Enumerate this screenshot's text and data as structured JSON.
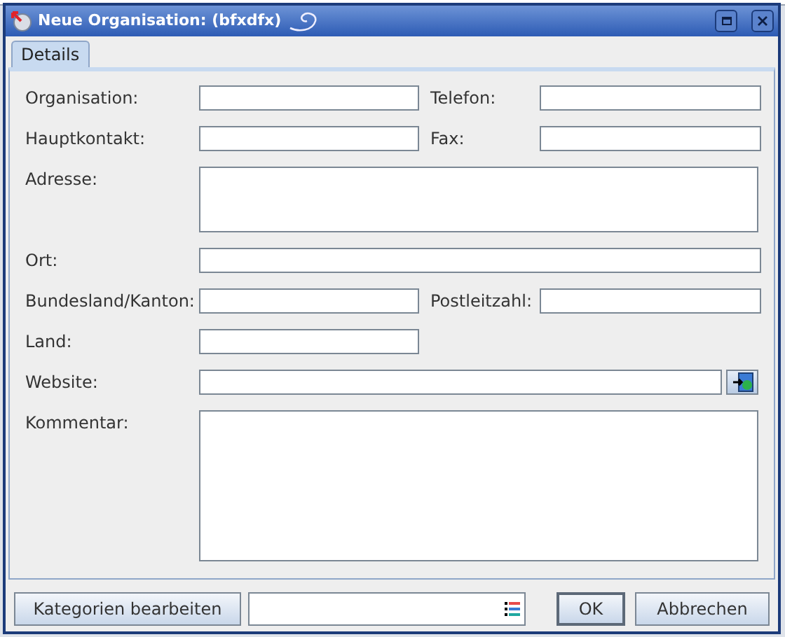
{
  "window": {
    "title": "Neue Organisation: (bfxdfx)"
  },
  "tabs": [
    {
      "label": "Details",
      "selected": true
    }
  ],
  "rows": [
    {
      "kind": "pair",
      "left": {
        "label": "Organisation:"
      },
      "right": {
        "label": "Telefon:"
      }
    },
    {
      "kind": "pair",
      "left": {
        "label": "Hauptkontakt:"
      },
      "right": {
        "label": "Fax:"
      }
    },
    {
      "kind": "area",
      "left": {
        "label": "Adresse:"
      }
    },
    {
      "kind": "wide",
      "left": {
        "label": "Ort:"
      }
    },
    {
      "kind": "pair",
      "left": {
        "label": "Bundesland/Kanton:"
      },
      "right": {
        "label": "Postleitzahl:"
      }
    },
    {
      "kind": "single",
      "left": {
        "label": "Land:"
      }
    },
    {
      "kind": "url",
      "left": {
        "label": "Website:"
      }
    },
    {
      "kind": "large_area",
      "left": {
        "label": "Kommentar:"
      }
    }
  ],
  "footer": {
    "categories_button": "Kategorien bearbeiten",
    "buttons": [
      {
        "label": "OK",
        "kind": "default"
      },
      {
        "label": "Abbrechen",
        "kind": "normal"
      }
    ]
  }
}
